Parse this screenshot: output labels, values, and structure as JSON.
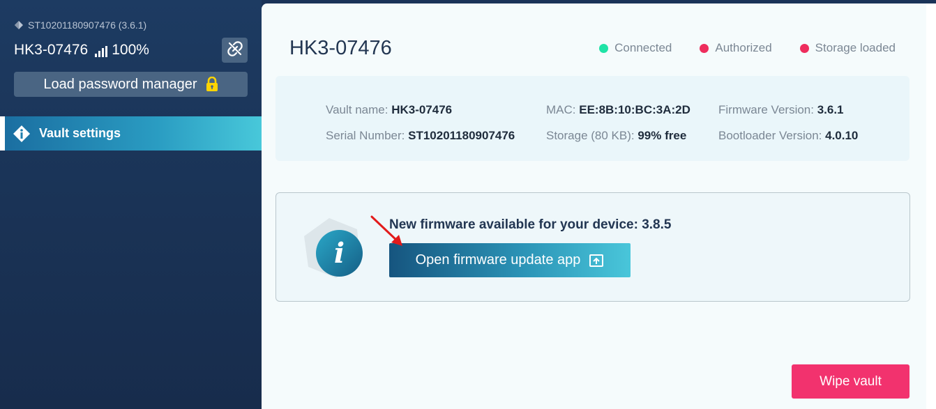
{
  "sidebar": {
    "serial_line": "ST10201180907476 (3.6.1)",
    "device_name": "HK3-07476",
    "battery": "100%",
    "load_pm_label": "Load password manager",
    "nav": [
      {
        "label": "Vault settings",
        "icon": "info-diamond-icon",
        "active": true
      }
    ]
  },
  "main": {
    "title": "HK3-07476",
    "statuses": [
      {
        "label": "Connected",
        "color": "#1fe3a6"
      },
      {
        "label": "Authorized",
        "color": "#ee2d5d"
      },
      {
        "label": "Storage loaded",
        "color": "#ee2d5d"
      }
    ],
    "info": {
      "vault_name_label": "Vault name: ",
      "vault_name": "HK3-07476",
      "serial_label": "Serial Number: ",
      "serial": "ST10201180907476",
      "mac_label": "MAC: ",
      "mac": "EE:8B:10:BC:3A:2D",
      "storage_label": "Storage (80 KB): ",
      "storage": "99% free",
      "firmware_label": "Firmware Version: ",
      "firmware": "3.6.1",
      "bootloader_label": "Bootloader Version: ",
      "bootloader": "4.0.10"
    },
    "firmware_card": {
      "message": "New firmware available for your device: 3.8.5",
      "button_label": "Open firmware update app",
      "info_glyph": "i"
    },
    "wipe_label": "Wipe vault"
  },
  "colors": {
    "accent_pink": "#f2326e",
    "connected_green": "#1fe3a6",
    "status_red": "#ee2d5d"
  }
}
